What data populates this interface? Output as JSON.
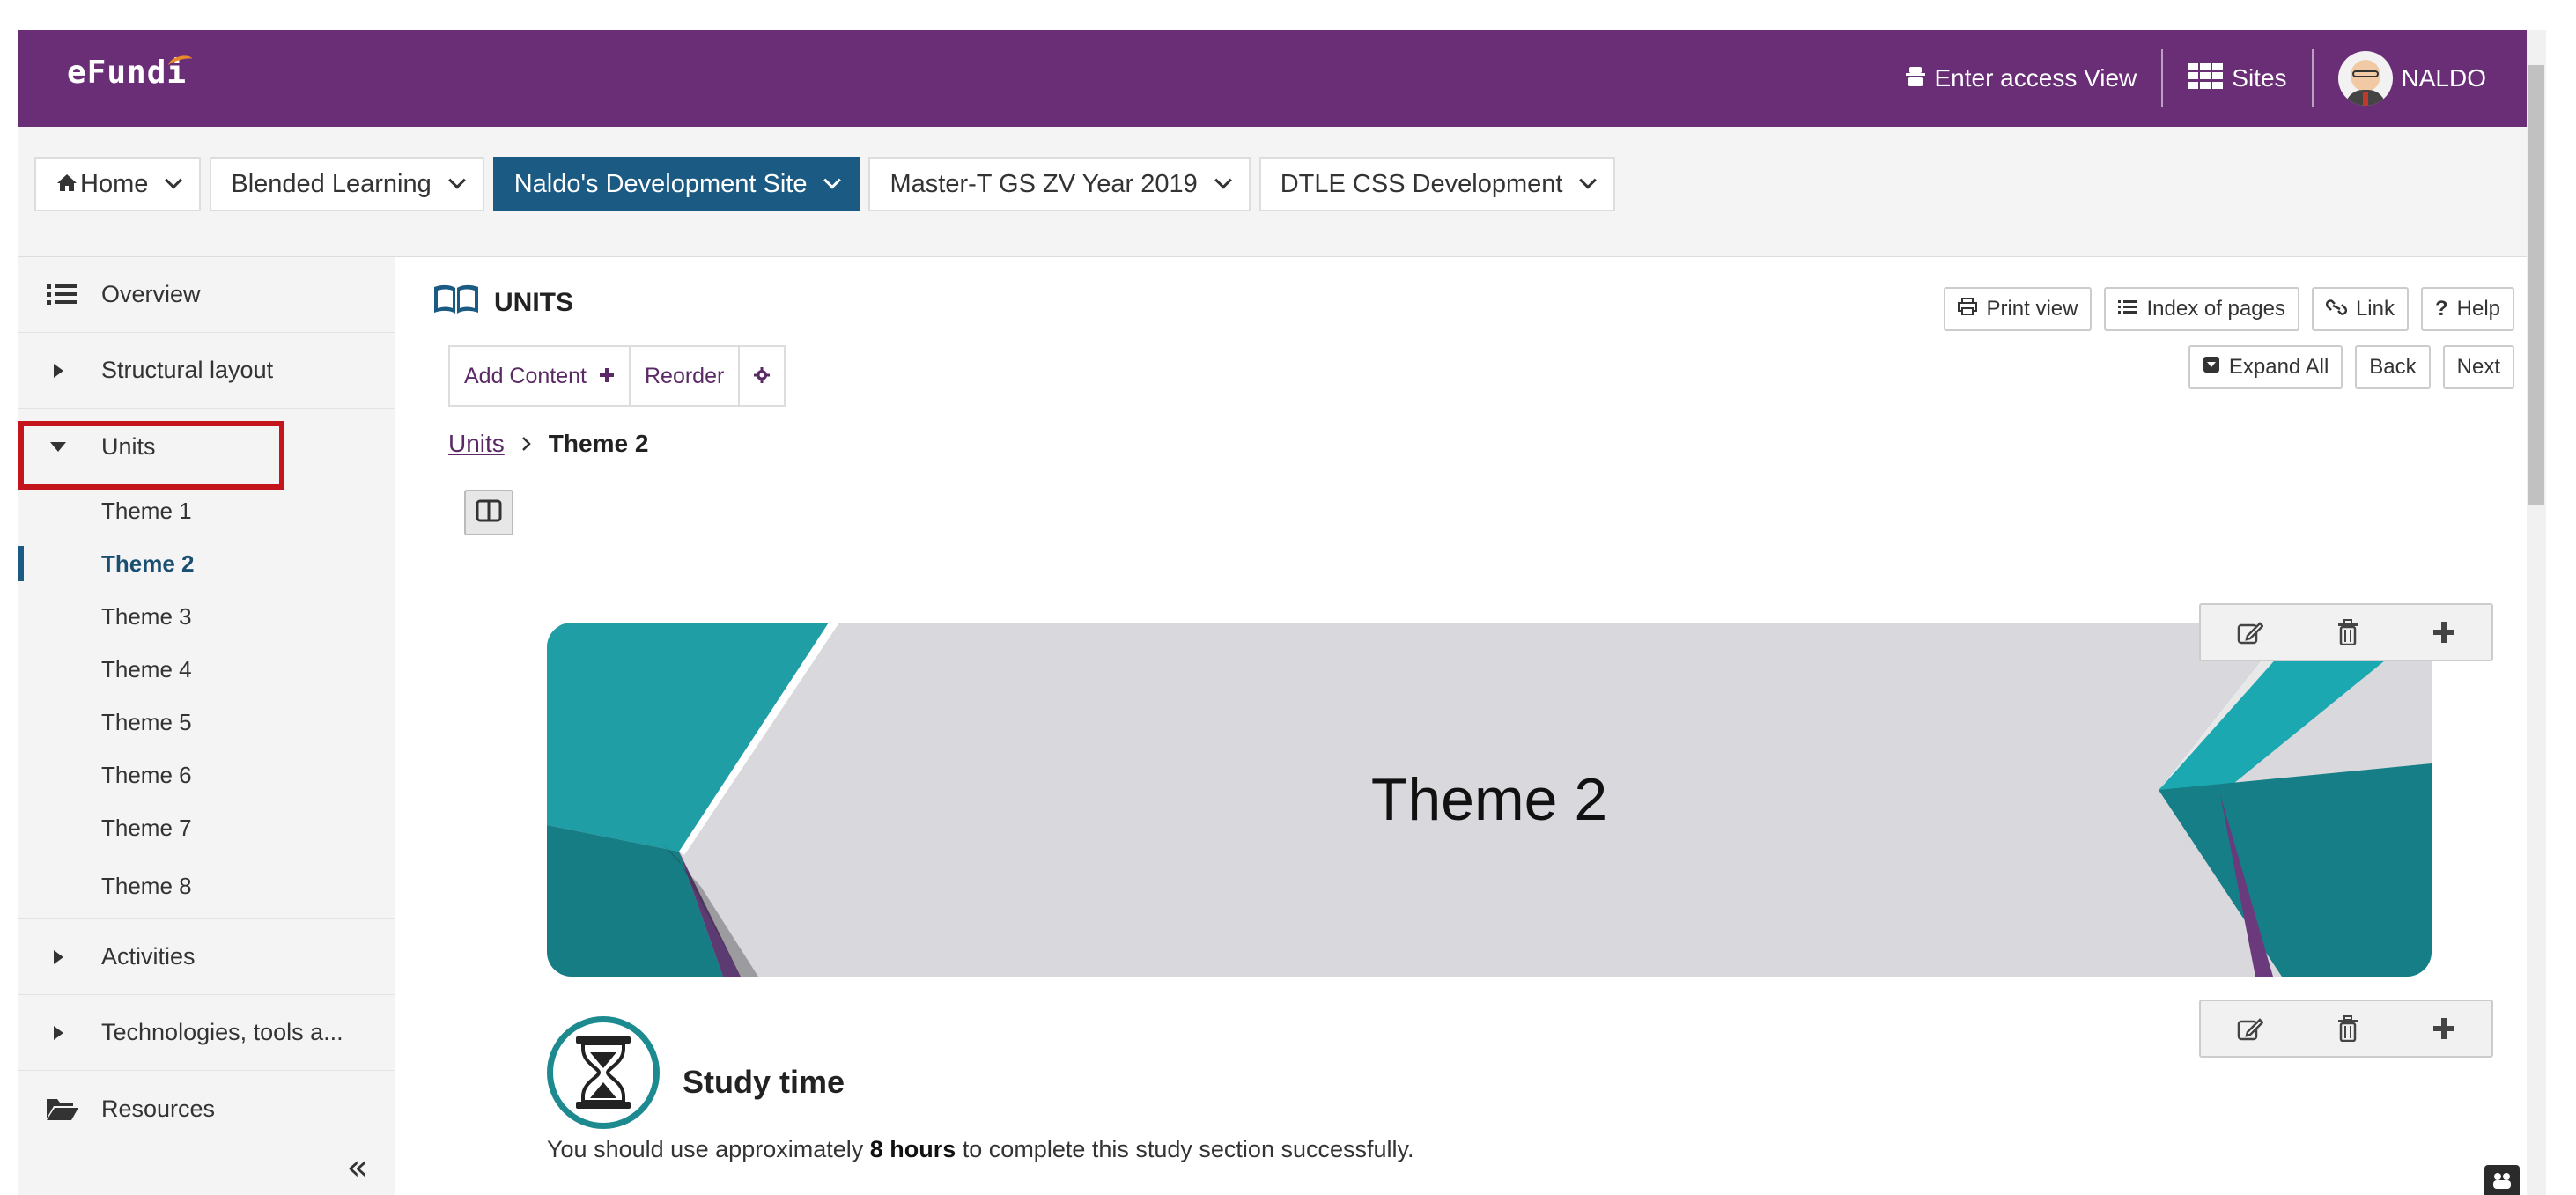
{
  "app": {
    "logo": "eFundi"
  },
  "topbar": {
    "access_view": "Enter access View",
    "sites": "Sites",
    "user": "NALDO"
  },
  "site_tabs": [
    {
      "label": "Home",
      "active": false
    },
    {
      "label": "Blended Learning",
      "active": false
    },
    {
      "label": "Naldo's Development Site",
      "active": true
    },
    {
      "label": "Master-T GS ZV Year 2019",
      "active": false
    },
    {
      "label": "DTLE CSS Development",
      "active": false
    }
  ],
  "sidebar": {
    "overview": "Overview",
    "structural_layout": "Structural layout",
    "units": "Units",
    "themes": [
      "Theme 1",
      "Theme 2",
      "Theme 3",
      "Theme 4",
      "Theme 5",
      "Theme 6",
      "Theme 7",
      "Theme 8"
    ],
    "active_theme": "Theme 2",
    "activities": "Activities",
    "technologies": "Technologies, tools a...",
    "resources": "Resources",
    "collapse": "«"
  },
  "main": {
    "page_title": "UNITS",
    "add_content": "Add Content",
    "reorder": "Reorder",
    "print_view": "Print view",
    "index_of_pages": "Index of pages",
    "link": "Link",
    "help": "Help",
    "expand_all": "Expand All",
    "back": "Back",
    "next": "Next",
    "breadcrumb_root": "Units",
    "breadcrumb_current": "Theme 2",
    "banner_title": "Theme 2",
    "study_title": "Study time",
    "study_text_before": "You should use approximately ",
    "study_text_bold": "8 hours",
    "study_text_after": " to complete this study section successfully."
  },
  "colors": {
    "topbar": "#6a2e77",
    "active_tab": "#1b5a83",
    "highlight": "#c4151c",
    "teal": "#1d8a8f"
  }
}
